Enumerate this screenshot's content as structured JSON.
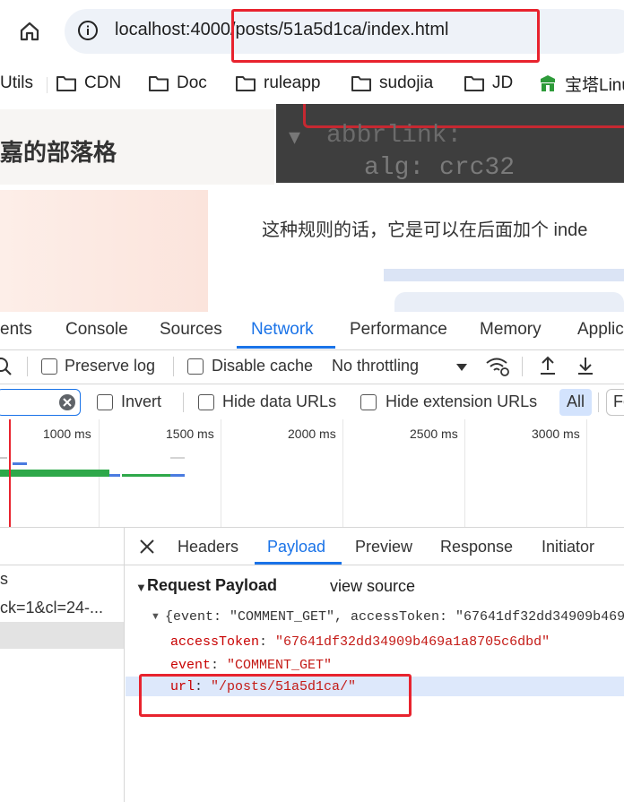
{
  "browser": {
    "url": "localhost:4000/posts/51a5d1ca/index.html",
    "bookmarks": [
      "Utils",
      "CDN",
      "Doc",
      "ruleapp",
      "sudojia",
      "JD",
      "宝塔Linu"
    ]
  },
  "page": {
    "heading": "嘉的部落格",
    "code_lines": [
      "abbrlink:",
      "alg: crc32"
    ],
    "article_text": "这种规则的话，它是可以在后面加个 inde"
  },
  "devtools": {
    "tabs": [
      "ents",
      "Console",
      "Sources",
      "Network",
      "Performance",
      "Memory",
      "Applic"
    ],
    "active_tab": "Network",
    "toolbar": {
      "preserve_log": "Preserve log",
      "disable_cache": "Disable cache",
      "throttling": "No throttling"
    },
    "filter_bar": {
      "invert": "Invert",
      "hide_data_urls": "Hide data URLs",
      "hide_extension_urls": "Hide extension URLs",
      "all": "All",
      "fe": "Fe"
    },
    "timeline_ticks": [
      "1000 ms",
      "1500 ms",
      "2000 ms",
      "2500 ms",
      "3000 ms"
    ],
    "request_list": {
      "header": "s",
      "row1": "ck=1&cl=24-..."
    },
    "detail_tabs": [
      "Headers",
      "Payload",
      "Preview",
      "Response",
      "Initiator"
    ],
    "active_detail_tab": "Payload",
    "payload": {
      "section_title": "Request Payload",
      "view_source": "view source",
      "summary": "{event: \"COMMENT_GET\", accessToken: \"67641df32dd34909b469",
      "fields": [
        {
          "key": "accessToken",
          "value": "\"67641df32dd34909b469a1a8705c6dbd\""
        },
        {
          "key": "event",
          "value": "\"COMMENT_GET\""
        },
        {
          "key": "url",
          "value": "\"/posts/51a5d1ca/\""
        }
      ]
    }
  },
  "colors": {
    "accent": "#1a73e8",
    "highlight_red": "#e8232e",
    "payload_key": "#c80000",
    "payload_string": "#c41a16"
  }
}
